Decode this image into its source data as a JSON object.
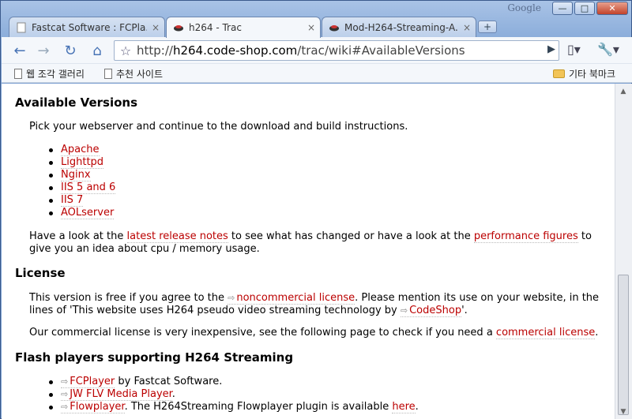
{
  "window": {
    "brand": "Google",
    "minimize": "—",
    "maximize": "□",
    "close": "✕"
  },
  "tabs": [
    {
      "title": "Fastcat Software : FCPla...",
      "close": "×"
    },
    {
      "title": "h264 - Trac",
      "close": "×"
    },
    {
      "title": "Mod-H264-Streaming-A...",
      "close": "×"
    }
  ],
  "toolbar": {
    "back": "←",
    "forward": "→",
    "reload": "↻",
    "home": "⌂",
    "url_prefix": "http://",
    "url_host": "h264.code-shop.com",
    "url_path": "/trac/wiki#AvailableVersions"
  },
  "bookmarks": {
    "item1": "웹 조각 갤러리",
    "item2": "추천 사이트",
    "other": "기타 북마크"
  },
  "page": {
    "available_versions": {
      "heading": "Available Versions",
      "intro": "Pick your webserver and continue to the download and build instructions.",
      "servers": [
        "Apache",
        "Lighttpd",
        "Nginx",
        "IIS 5 and 6",
        "IIS 7",
        "AOLserver"
      ],
      "look_1": "Have a look at the ",
      "look_link1": "latest release notes",
      "look_2": " to see what has changed or have a look at the ",
      "look_link2": "performance figures",
      "look_3": " to give you an idea about cpu / memory usage."
    },
    "license": {
      "heading": "License",
      "p1_1": "This version is free if you agree to the ",
      "p1_link": "noncommercial license",
      "p1_2": ". Please mention its use on your website, in the lines of 'This website uses H264 pseudo video streaming technology by ",
      "p1_link2": "CodeShop",
      "p1_3": "'.",
      "p2_1": "Our commercial license is very inexpensive, see the following page to check if you need a ",
      "p2_link": "commercial license",
      "p2_2": "."
    },
    "flash": {
      "heading": "Flash players supporting H264 Streaming",
      "item1_link": "FCPlayer",
      "item1_text": " by Fastcat Software.",
      "item2_link": "JW FLV Media Player",
      "item2_text": ".",
      "item3_link": "Flowplayer",
      "item3_text": ". The H264Streaming Flowplayer plugin is available ",
      "item3_link2": "here",
      "item3_end": "."
    }
  }
}
